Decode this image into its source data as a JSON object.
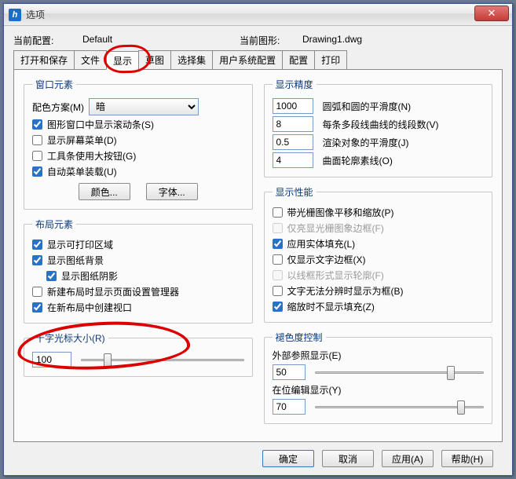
{
  "window": {
    "title": "选项"
  },
  "info": {
    "config_label": "当前配置:",
    "config_value": "Default",
    "drawing_label": "当前图形:",
    "drawing_value": "Drawing1.dwg"
  },
  "tabs": {
    "items": [
      {
        "label": "打开和保存"
      },
      {
        "label": "文件"
      },
      {
        "label": "显示"
      },
      {
        "label": "草图"
      },
      {
        "label": "选择集"
      },
      {
        "label": "用户系统配置"
      },
      {
        "label": "配置"
      },
      {
        "label": "打印"
      }
    ]
  },
  "left": {
    "window_elements": {
      "legend": "窗口元素",
      "scheme_label": "配色方案(M)",
      "scheme_value": "暗",
      "scrollbars": "图形窗口中显示滚动条(S)",
      "screen_menu": "显示屏幕菜单(D)",
      "big_buttons": "工具条使用大按钮(G)",
      "auto_menu": "自动菜单装载(U)",
      "color_btn": "颜色...",
      "font_btn": "字体..."
    },
    "layout_elements": {
      "legend": "布局元素",
      "print_area": "显示可打印区域",
      "paper_bg": "显示图纸背景",
      "paper_shadow": "显示图纸阴影",
      "page_setup": "新建布局时显示页面设置管理器",
      "create_viewport": "在新布局中创建视口"
    },
    "crosshair": {
      "legend": "十字光标大小(R)",
      "value": "100"
    }
  },
  "right": {
    "precision": {
      "legend": "显示精度",
      "arc_smooth": {
        "val": "1000",
        "lbl": "圆弧和圆的平滑度(N)"
      },
      "poly_seg": {
        "val": "8",
        "lbl": "每条多段线曲线的线段数(V)"
      },
      "render_smooth": {
        "val": "0.5",
        "lbl": "渲染对象的平滑度(J)"
      },
      "surf_lines": {
        "val": "4",
        "lbl": "曲面轮廓素线(O)"
      }
    },
    "performance": {
      "legend": "显示性能",
      "raster_pan": "带光栅图像平移和缩放(P)",
      "hl_raster_frame": "仅亮显光栅图象边框(F)",
      "solid_fill": "应用实体填充(L)",
      "text_frame": "仅显示文字边框(X)",
      "wire_silh": "以线框形式显示轮廓(F)",
      "true_type": "文字无法分辨时显示为框(B)",
      "no_fill_zoom": "缩放时不显示填充(Z)"
    },
    "fade": {
      "legend": "褪色度控制",
      "xref_label": "外部参照显示(E)",
      "xref_value": "50",
      "inplace_label": "在位编辑显示(Y)",
      "inplace_value": "70"
    }
  },
  "buttons": {
    "ok": "确定",
    "cancel": "取消",
    "apply": "应用(A)",
    "help": "帮助(H)"
  }
}
